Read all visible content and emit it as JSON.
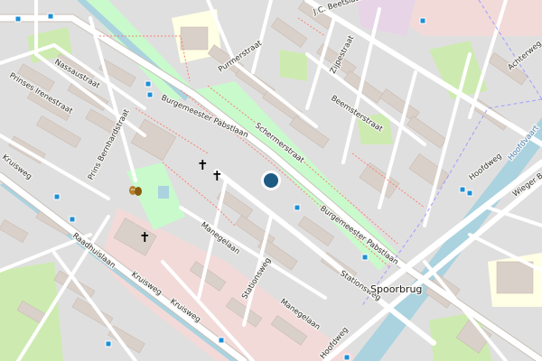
{
  "map": {
    "background": "#f2efe9",
    "colors": {
      "building": "#d9d0c9",
      "building_stroke": "#c4b6ab",
      "residential": "#e0dfdf",
      "park": "#c8facc",
      "grass": "#cdebb0",
      "water": "#aad3df",
      "road": "#ffffff",
      "path": "#fa8072",
      "school": "#ffffe5",
      "commercial": "#f2dad9",
      "marker": "#1f5a82",
      "bus_stop": "#1d8fd6"
    },
    "streets": [
      {
        "id": "nassaustraat",
        "label": "Nassaustraat"
      },
      {
        "id": "prinses-irenestraat",
        "label": "Prinses Irenestraat"
      },
      {
        "id": "prins-bernhardstraat",
        "label": "Prins Bernhardstraat"
      },
      {
        "id": "kruisweg-left",
        "label": "Kruisweg"
      },
      {
        "id": "raadhuislaan",
        "label": "Raadhuislaan"
      },
      {
        "id": "kruisweg-bottom-1",
        "label": "Kruisweg"
      },
      {
        "id": "kruisweg-bottom-2",
        "label": "Kruisweg"
      },
      {
        "id": "purmerstraat",
        "label": "Purmerstraat"
      },
      {
        "id": "burgemeester-pabstlaan-top",
        "label": "Burgemeester Pabstlaan"
      },
      {
        "id": "schermerstraat",
        "label": "Schermerstraat"
      },
      {
        "id": "jc-beetslaan",
        "label": "J.C. Beetslaan"
      },
      {
        "id": "zijpestraat",
        "label": "Zijpestraat"
      },
      {
        "id": "beemsterstraat",
        "label": "Beemsterstraat"
      },
      {
        "id": "achterweg",
        "label": "Achterweg"
      },
      {
        "id": "burgemeester-pabstlaan-bottom",
        "label": "Burgemeester Pabstlaan"
      },
      {
        "id": "manegelaan-1",
        "label": "Manegelaan"
      },
      {
        "id": "manegelaan-2",
        "label": "Manegelaan"
      },
      {
        "id": "stationsweg-1",
        "label": "Stationsweg"
      },
      {
        "id": "stationsweg-2",
        "label": "Stationsweg"
      },
      {
        "id": "hoofdweg-right",
        "label": "Hoofdweg"
      },
      {
        "id": "hoofdweg-bottom",
        "label": "Hoofdweg"
      },
      {
        "id": "wieger-bruinlaan",
        "label": "Wieger Br"
      }
    ],
    "waterways": [
      {
        "id": "hoofdvaart",
        "label": "Hoofdvaart"
      }
    ],
    "places": [
      {
        "id": "spoorbrug",
        "label": "Spoorbrug"
      }
    ],
    "icons": [
      {
        "id": "church-1",
        "icon": "cross-icon",
        "glyph": "✝"
      },
      {
        "id": "church-2",
        "icon": "cross-icon",
        "glyph": "✝"
      },
      {
        "id": "church-3",
        "icon": "cross-icon",
        "glyph": "✝"
      },
      {
        "id": "theatre",
        "icon": "theatre-masks-icon",
        "glyph": "🎭"
      }
    ],
    "bus_stops": 14
  }
}
